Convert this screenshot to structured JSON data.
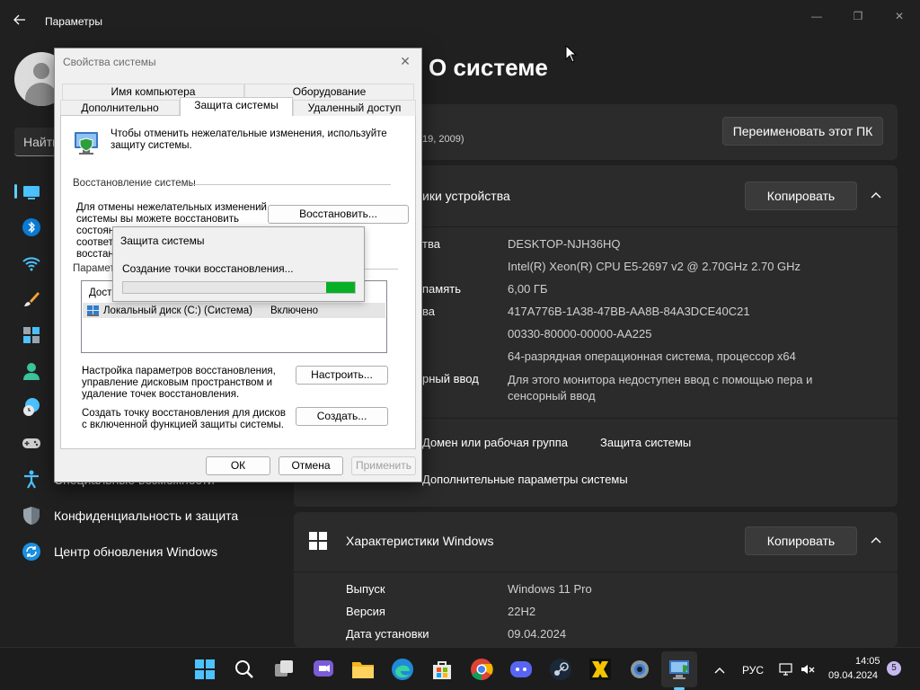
{
  "settings": {
    "app_title": "Параметры",
    "search_placeholder": "Найти",
    "nav": [
      {
        "icon": "system-icon",
        "label": ""
      },
      {
        "icon": "bluetooth-icon",
        "label": ""
      },
      {
        "icon": "network-icon",
        "label": ""
      },
      {
        "icon": "personalization-icon",
        "label": ""
      },
      {
        "icon": "apps-icon",
        "label": ""
      },
      {
        "icon": "accounts-icon",
        "label": ""
      },
      {
        "icon": "time-language-icon",
        "label": ""
      },
      {
        "icon": "gaming-icon",
        "label": ""
      },
      {
        "icon": "accessibility-icon",
        "label": "Специальные возможности"
      },
      {
        "icon": "privacy-shield-icon",
        "label": "Конфиденциальность и защита"
      },
      {
        "icon": "windows-update-icon",
        "label": "Центр обновления Windows"
      }
    ],
    "page_title": "О системе",
    "device_card": {
      "subtitle": "19, 2009)",
      "rename_label": "Переименовать этот ПК"
    },
    "specs_card": {
      "title": "ики устройства",
      "copy_label": "Копировать",
      "rows": [
        {
          "key": "тва",
          "value": "DESKTOP-NJH36HQ"
        },
        {
          "key": "",
          "value": "Intel(R) Xeon(R) CPU E5-2697 v2 @ 2.70GHz   2.70 GHz"
        },
        {
          "key": "память",
          "value": "6,00 ГБ"
        },
        {
          "key": "ва",
          "value": "417A776B-1A38-47BB-AA8B-84A3DCE40C21"
        },
        {
          "key": "",
          "value": "00330-80000-00000-AA225"
        },
        {
          "key": "",
          "value": "64-разрядная операционная система, процессор x64"
        },
        {
          "key": "рный ввод",
          "value": "Для этого монитора недоступен ввод с помощью пера и сенсорный ввод"
        }
      ],
      "links": [
        "Домен или рабочая группа",
        "Защита системы",
        "Дополнительные параметры системы"
      ]
    },
    "windows_card": {
      "title": "Характеристики Windows",
      "copy_label": "Копировать",
      "rows": [
        {
          "key": "Выпуск",
          "value": "Windows 11 Pro"
        },
        {
          "key": "Версия",
          "value": "22H2"
        },
        {
          "key": "Дата установки",
          "value": "09.04.2024"
        }
      ]
    }
  },
  "dialog": {
    "title": "Свойства системы",
    "tabs_top": [
      "Имя компьютера",
      "Оборудование"
    ],
    "tabs_bottom": [
      "Дополнительно",
      "Защита системы",
      "Удаленный доступ"
    ],
    "intro": "Чтобы отменить нежелательные изменения, используйте защиту системы.",
    "restore_group": "Восстановление системы",
    "restore_text_1": "Для отмены нежелательных изменений",
    "restore_text_2": "системы вы можете восстановить",
    "restore_text_3": "состоян",
    "restore_text_4": "соответ",
    "restore_text_5": "восстан",
    "restore_button": "Восстановить...",
    "params_group": "Парамет",
    "list_header": "Дост",
    "list_row_name": "Локальный диск (C:) (Система)",
    "list_row_state": "Включено",
    "configure_text": "Настройка параметров восстановления, управление дисковым пространством и удаление точек восстановления.",
    "configure_button": "Настроить...",
    "create_text": "Создать точку восстановления для дисков с включенной функцией защиты системы.",
    "create_button": "Создать...",
    "ok": "ОК",
    "cancel": "Отмена",
    "apply": "Применить"
  },
  "progress_popup": {
    "title": "Защита системы",
    "message": "Создание точки восстановления...",
    "progress_color": "#06b025"
  },
  "taskbar": {
    "icons": [
      "start-icon",
      "search-icon",
      "task-view-icon",
      "chat-icon",
      "file-explorer-icon",
      "edge-icon",
      "store-icon",
      "chrome-icon",
      "discord-icon",
      "steam-icon",
      "hub-icon",
      "settings-icon",
      "system-properties-icon"
    ],
    "lang": "РУС",
    "time": "14:05",
    "date": "09.04.2024",
    "notifications": "5"
  }
}
